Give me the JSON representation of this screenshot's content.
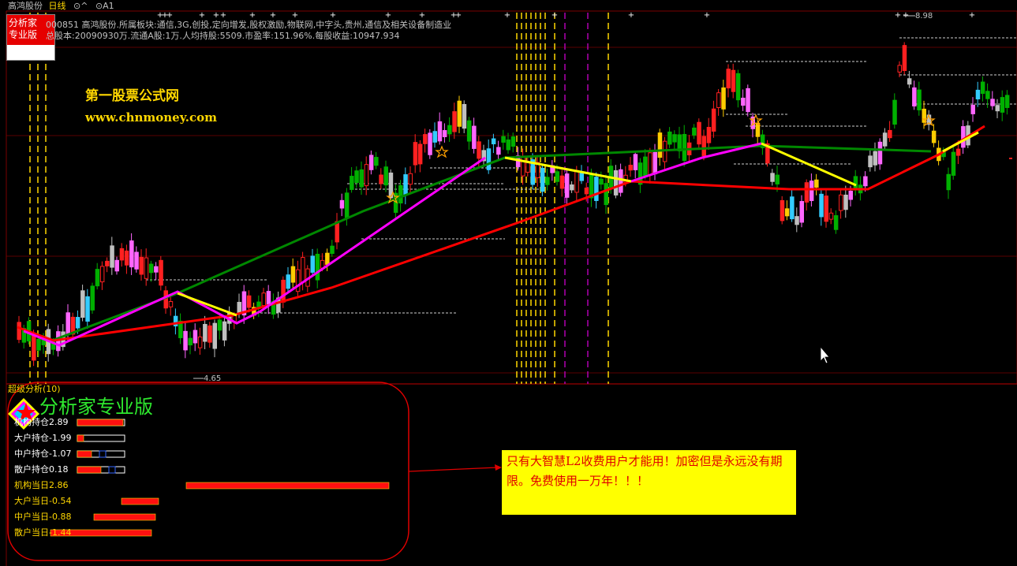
{
  "header": {
    "stock_name": "高鸿股份",
    "cycle": "日线",
    "controls": [
      "⊙^",
      "⊙A1"
    ]
  },
  "logo": {
    "line1": "分析家",
    "line2": "专业版"
  },
  "info": {
    "line1": "000851 高鸿股份.所属板块:通信,3G,创投,定向增发,股权激励,物联网,中字头,贵州,通信及相关设备制造业",
    "line2": "总股本:20090930万.流通A股:1万.人均持股:5509.市盈率:151.96%.每股收益:10947.934"
  },
  "watermark": {
    "cn": "第一股票公式网",
    "url": "www.chnmoney.com"
  },
  "price_labels": {
    "high": "8.98",
    "low": "4.65"
  },
  "panel": {
    "title": "超级分析(10)",
    "brand": "分析家专业版",
    "metrics": [
      {
        "label": "机构持仓2.89",
        "color": "#ffffff",
        "value": 2.89
      },
      {
        "label": "大户持仓-1.99",
        "color": "#ffffff",
        "value": -1.99
      },
      {
        "label": "中户持仓-1.07",
        "color": "#ffffff",
        "value": -1.07
      },
      {
        "label": "散户持仓0.18",
        "color": "#ffffff",
        "value": 0.18
      },
      {
        "label": "机构当日2.86",
        "color": "#ffd700",
        "value": 2.86
      },
      {
        "label": "大户当日-0.54",
        "color": "#ffd700",
        "value": -0.54
      },
      {
        "label": "中户当日-0.88",
        "color": "#ffd700",
        "value": -0.88
      },
      {
        "label": "散户当日-1.44",
        "color": "#ffd700",
        "value": -1.44
      }
    ]
  },
  "note": {
    "text": "只有大智慧L2收费用户才能用！加密但是永远没有期限。免费使用一万年！！！"
  },
  "colors": {
    "up_candle": "#ff2020",
    "down_candle": "#00b000",
    "pink_candle": "#ff66ff",
    "cyan_candle": "#33ccff",
    "silver_candle": "#c0c0c0",
    "trend_green": "#008800",
    "trend_red": "#ff0000",
    "trend_magenta": "#ff00ff",
    "trend_yellow": "#ffff00"
  }
}
